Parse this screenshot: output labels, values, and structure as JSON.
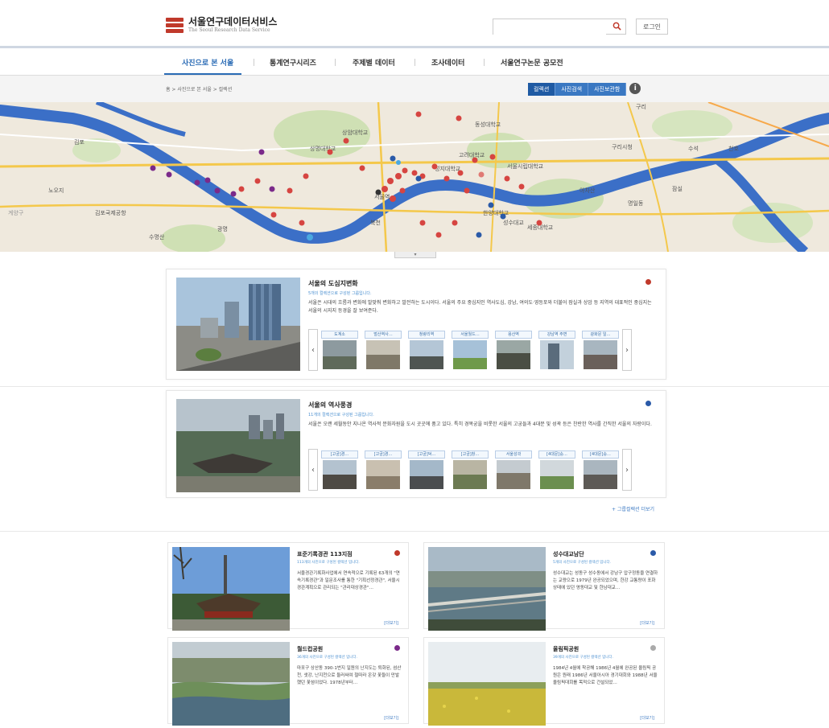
{
  "header": {
    "logo_title": "서울연구데이터서비스",
    "logo_subtitle": "The Seoul Research Data Service",
    "search_placeholder": "",
    "login_label": "로그인",
    "search_icon": "search-icon"
  },
  "nav": {
    "items": [
      {
        "label": "사진으로 본 서울",
        "active": true
      },
      {
        "label": "통계연구시리즈",
        "active": false
      },
      {
        "label": "주제별 데이터",
        "active": false
      },
      {
        "label": "조사데이터",
        "active": false
      },
      {
        "label": "서울연구논문 공모전",
        "active": false
      }
    ]
  },
  "breadcrumb": "홈 > 사진으로 본 서울 > 컬렉션",
  "view_tabs": [
    {
      "label": "컬렉션",
      "active": true
    },
    {
      "label": "사진검색",
      "active": false
    },
    {
      "label": "사진보관함",
      "active": false
    }
  ],
  "map": {
    "labels": [
      "김포",
      "김포국제공항",
      "노오지",
      "계양구",
      "광명",
      "수명산",
      "상암대학교",
      "북천",
      "성지대학교",
      "고려대학교",
      "동성대학교",
      "상명대학교",
      "서울시립대학교",
      "구리시청",
      "아차산",
      "한양대학교",
      "성수대교",
      "서울역",
      "세종대학교",
      "명일동",
      "잠실",
      "수석",
      "천호",
      "구리"
    ],
    "toggle_label": "▾"
  },
  "collections": [
    {
      "title": "서울의 도심지변화",
      "count": "5개의 컬렉션으로 구성된 그룹입니다.",
      "desc": "서울은 시대의 흐름과 변화에 발맞춰 변화하고 발전하는 도시이다. 서울의 주요 중심지인 역사도심, 강남, 여의도·영등포와 더불어 잠실과 상암 등 지역의 대표적인 중심지는 서울의 시지지 등경을 잘 보여준다.",
      "dot_color": "#c0392b",
      "items": [
        "도계소",
        "벌산역사…",
        "청량리역",
        "서울월드…",
        "용산역",
        "강남역 주변",
        "광화문 일…"
      ]
    },
    {
      "title": "서울의 역사풍경",
      "count": "11개의 컬렉션으로 구성된 그룹입니다.",
      "desc": "서울은 오랜 세월동안 지나온 역사적 문화자원을 도시 곳곳에 품고 있다. 특히 경복궁을 비롯한 서울의 고궁들과 4대문 및 성곽 등은 찬란한 역사를 간직한 서울의 자랑이다.",
      "dot_color": "#2a5aa8",
      "items": [
        "[고궁]경…",
        "[고궁]경…",
        "[고궁]덕…",
        "[고궁]창…",
        "서울성곽",
        "[4대문]숭…",
        "[4대문]숭…"
      ]
    }
  ],
  "more_groups": "+ 그룹컬렉션 더보기",
  "cards": [
    {
      "title": "표준기록경관 113지점",
      "count": "113개의 사진으로 구성된 컬렉션 입니다.",
      "desc": "서울경관기록화사업에서 연속적으로 기록된 63개의 \"연속기록경관\"과 일문조사를 통한 \"기획선정경관\", 서울시 경관계획으로 관리되는 \"관리대상경관\"…",
      "dot_color": "#c0392b",
      "more": "[더보기]"
    },
    {
      "title": "성수대교남단",
      "count": "5개의 사진으로 구성된 컬렉션 입니다.",
      "desc": "성수대교는 성동구 성수동에서 강남구 압구정동을 연결하는 교량으로 1979년 완공되었으며, 한강 교통량이 포화상태에 있던 영동대교 및 한남대교…",
      "dot_color": "#2a5aa8",
      "more": "[더보기]"
    },
    {
      "title": "월드컵공원",
      "count": "36개의 사진으로 구성된 컬렉션 입니다.",
      "desc": "마포구 상산동 390-1번지 일원의 난지도는 퇴화된, 섬산천, 샛강, 난지천으로 둘러싸여 철따라 온갖 꽃들이 만발했던 꽃섬이었다. 1978년부터…",
      "dot_color": "#7b2a8a",
      "more": "[더보기]"
    },
    {
      "title": "올림픽공원",
      "count": "39개의 사진으로 구성된 컬렉션 입니다.",
      "desc": "1984년 4월에 착공해 1986년 4월에 완공된 올림픽 공원은 원래 1986년 서울아시아 경기대회와 1988년 서울올림픽대회를 목적으로 건설되었…",
      "dot_color": "#aaaaaa",
      "more": "[더보기]"
    }
  ]
}
